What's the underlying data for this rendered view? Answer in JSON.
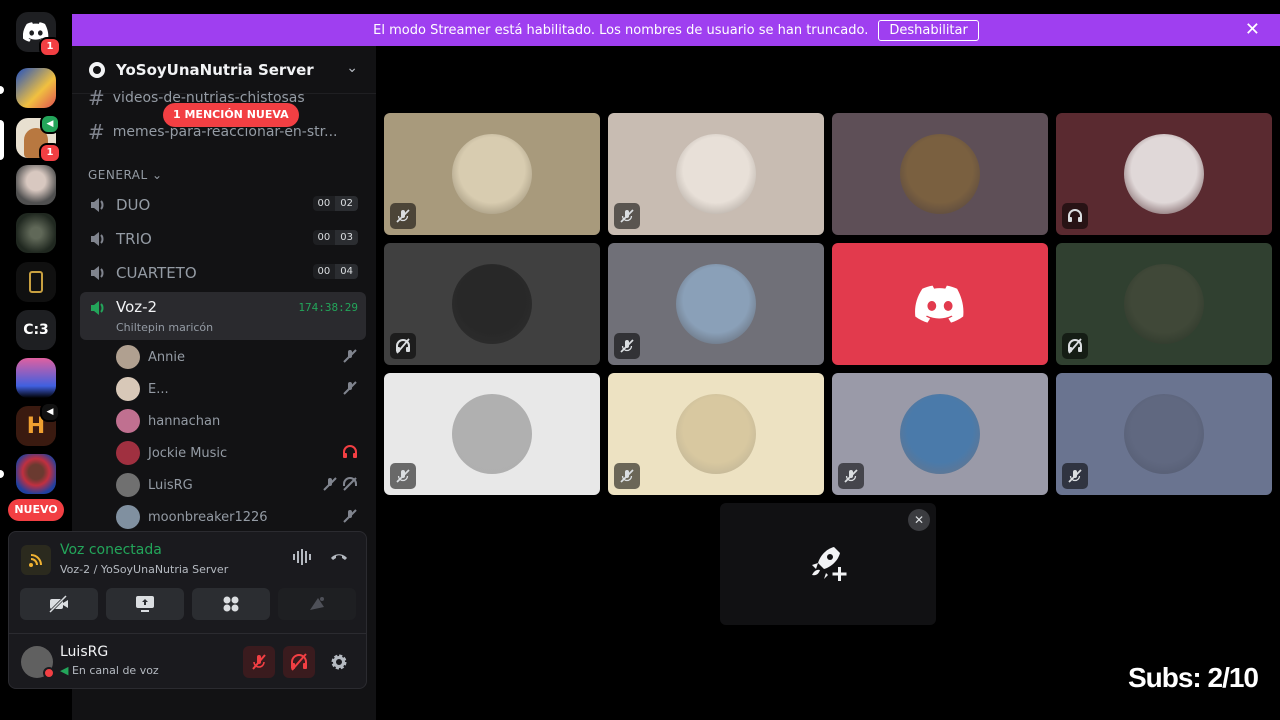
{
  "banner": {
    "text": "El modo Streamer está habilitado. Los nombres de usuario se han truncado.",
    "button": "Deshabilitar"
  },
  "rail": {
    "home_badge": "1",
    "server_badge": "1",
    "c3_label": "C:3",
    "new_label": "NUEVO"
  },
  "server": {
    "name": "YoSoyUnaNutria Server"
  },
  "text_channels": [
    {
      "name": "videos-de-nutrias-chistosas"
    },
    {
      "name": "memes-para-reaccionar-en-str..."
    }
  ],
  "mention_pill": "1 MENCIÓN NUEVA",
  "category": "GENERAL",
  "voice_channels": [
    {
      "name": "DUO",
      "count": "00",
      "limit": "02"
    },
    {
      "name": "TRIO",
      "count": "00",
      "limit": "03"
    },
    {
      "name": "CUARTETO",
      "count": "00",
      "limit": "04"
    }
  ],
  "active_voice": {
    "name": "Voz-2",
    "status": "Chiltepin maricón",
    "timer": "174:38:29"
  },
  "members": [
    {
      "name": "Annie",
      "color": "#b0a090"
    },
    {
      "name": "E...",
      "color": "#d8c8b8"
    },
    {
      "name": "hannachan",
      "color": "#c07090"
    },
    {
      "name": "Jockie Music",
      "color": "#a03040"
    },
    {
      "name": "LuisRG",
      "color": "#707070"
    },
    {
      "name": "moonbreaker1226",
      "color": "#8090a0"
    }
  ],
  "voice_panel": {
    "title": "Voz conectada",
    "subtitle": "Voz-2 / YoSoyUnaNutria Server"
  },
  "user": {
    "name": "LuisRG",
    "status": "En canal de voz"
  },
  "tiles": [
    {
      "bg": "#a89a7c",
      "av": "#d8ccb0",
      "icon": "mic-off-icon"
    },
    {
      "bg": "#c8bcb2",
      "av": "#e8e0d8",
      "icon": "mic-off-icon"
    },
    {
      "bg": "#5e4f57",
      "av": "#7a6040",
      "icon": ""
    },
    {
      "bg": "#5a2a30",
      "av": "#e0d8d8",
      "icon": "headphones-icon"
    },
    {
      "bg": "#404040",
      "av": "#282828",
      "icon": "deafen-icon"
    },
    {
      "bg": "#707078",
      "av": "#8aa0b8",
      "icon": "mic-off-icon"
    },
    {
      "bg": "#e23a4d",
      "av": "",
      "icon": ""
    },
    {
      "bg": "#304030",
      "av": "#404838",
      "icon": "deafen-icon"
    },
    {
      "bg": "#e8e8e8",
      "av": "#b0b0b0",
      "icon": "mic-off-icon"
    },
    {
      "bg": "#ede2c2",
      "av": "#d8c8a0",
      "icon": "mic-off-icon"
    },
    {
      "bg": "#9a9aa8",
      "av": "#4a7aaa",
      "icon": "mic-off-icon"
    },
    {
      "bg": "#6a7490",
      "av": "#606880",
      "icon": "mic-off-icon"
    }
  ],
  "overlay": {
    "subs": "Subs: 2/10"
  }
}
